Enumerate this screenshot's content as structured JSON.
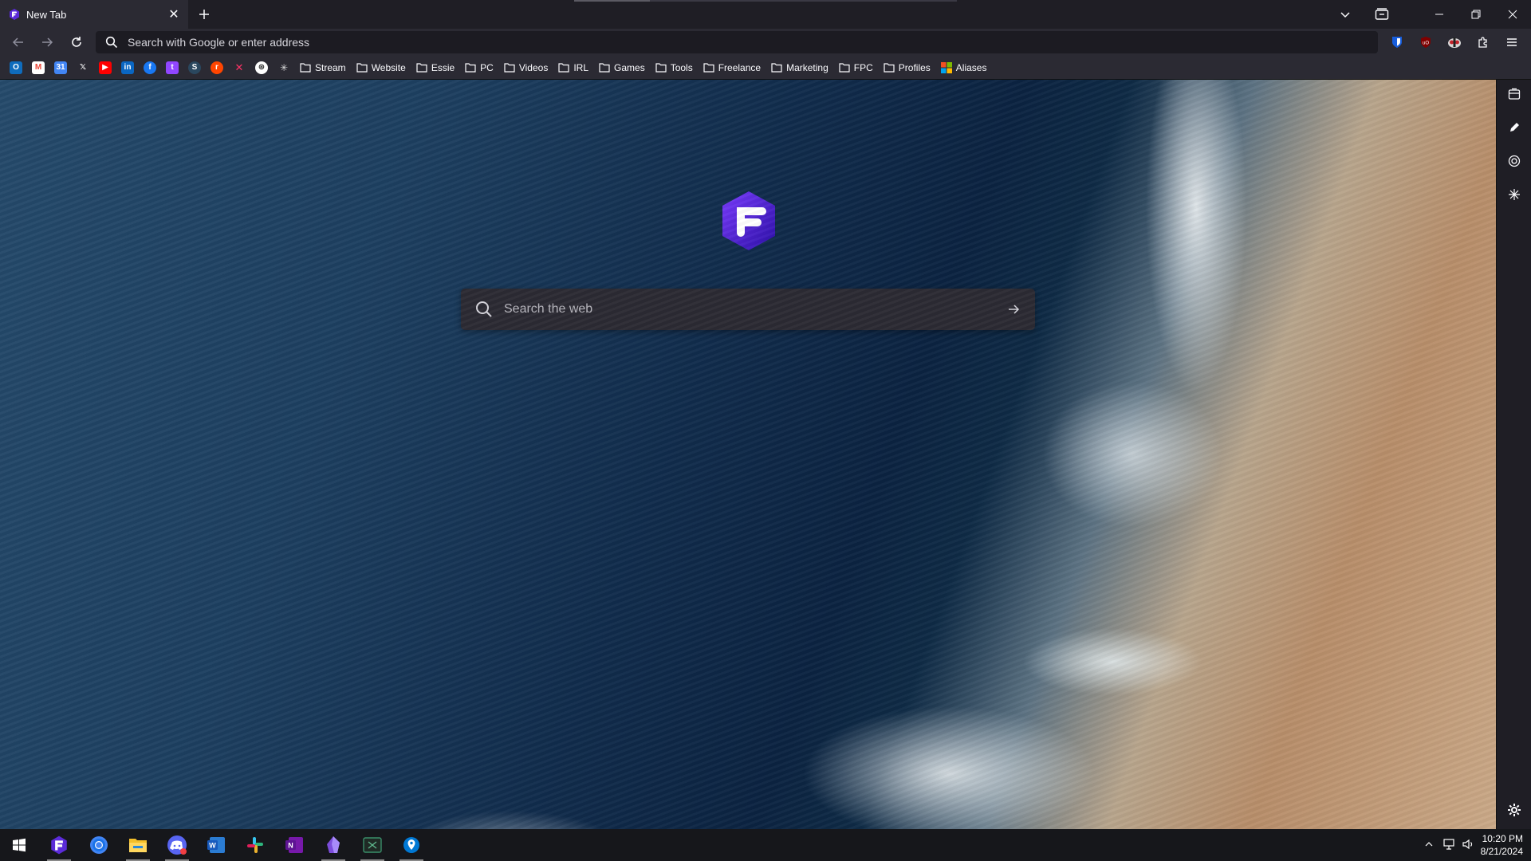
{
  "browser": {
    "tab": {
      "title": "New Tab",
      "favicon": "floorp-icon"
    },
    "new_tab_icon": "plus-icon",
    "window_controls": [
      "list-all-tabs-icon",
      "firefox-view-icon",
      "minimize-icon",
      "restore-icon",
      "close-icon"
    ]
  },
  "navbar": {
    "back_icon": "arrow-left-icon",
    "forward_icon": "arrow-right-icon",
    "reload_icon": "reload-icon",
    "address_placeholder": "Search with Google or enter address",
    "extensions": [
      "bitwarden-icon",
      "ublock-origin-icon",
      "privacy-badger-icon",
      "extensions-puzzle-icon",
      "menu-icon"
    ]
  },
  "bookmarks": {
    "favicons": [
      "outlook-icon",
      "gmail-icon",
      "google-calendar-icon",
      "x-icon",
      "youtube-icon",
      "linkedin-icon",
      "facebook-icon",
      "twitch-icon",
      "steam-icon",
      "reddit-icon",
      "nexus-icon",
      "chatgpt-icon",
      "perplexity-icon"
    ],
    "folders": [
      "Stream",
      "Website",
      "Essie",
      "PC",
      "Videos",
      "IRL",
      "Games",
      "Tools",
      "Freelance",
      "Marketing",
      "FPC",
      "Profiles"
    ],
    "last_item": "Aliases"
  },
  "newtab": {
    "search_placeholder": "Search the web",
    "search_icon": "search-icon",
    "go_icon": "arrow-right-icon"
  },
  "sidebar": {
    "icons": [
      "bookmarks-sidebar-icon",
      "notes-icon",
      "chatgpt-icon",
      "perplexity-icon"
    ],
    "settings_icon": "gear-icon"
  },
  "taskbar": {
    "apps": [
      "windows-start-icon",
      "floorp-icon",
      "chrome-icon",
      "file-explorer-icon",
      "discord-icon",
      "word-icon",
      "slack-icon",
      "onenote-icon",
      "obsidian-icon",
      "terminal-icon",
      "maps-icon"
    ],
    "time": "10:20 PM",
    "date": "8/21/2024"
  },
  "colors": {
    "floorp_purple": "#5b2bd9",
    "chrome_bg": "#2b2a33",
    "accent_blue": "#175ddc"
  }
}
